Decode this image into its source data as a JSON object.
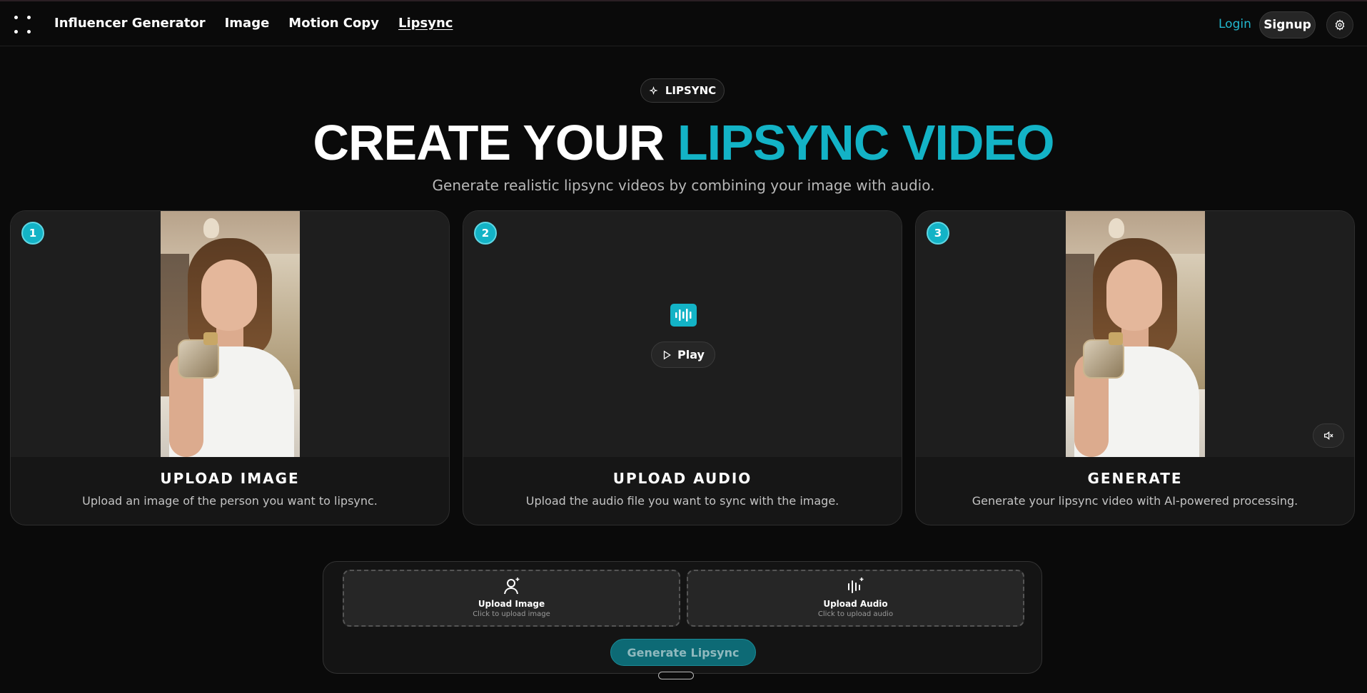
{
  "nav": {
    "links": [
      {
        "label": "Influencer Generator",
        "active": false
      },
      {
        "label": "Image",
        "active": false
      },
      {
        "label": "Motion Copy",
        "active": false
      },
      {
        "label": "Lipsync",
        "active": true
      }
    ],
    "login_label": "Login",
    "signup_label": "Signup",
    "settings_icon": "gear-icon"
  },
  "hero": {
    "badge": "LIPSYNC",
    "title_plain": "CREATE YOUR",
    "title_accent": "LIPSYNC VIDEO",
    "subtitle": "Generate realistic lipsync videos by combining your image with audio."
  },
  "steps": [
    {
      "number": "1",
      "title": "UPLOAD IMAGE",
      "description": "Upload an image of the person you want to lipsync."
    },
    {
      "number": "2",
      "title": "UPLOAD AUDIO",
      "description": "Upload the audio file you want to sync with the image.",
      "play_label": "Play"
    },
    {
      "number": "3",
      "title": "GENERATE",
      "description": "Generate your lipsync video with AI-powered processing."
    }
  ],
  "upload": {
    "image_title": "Upload Image",
    "image_sub": "Click to upload image",
    "audio_title": "Upload Audio",
    "audio_sub": "Click to upload audio",
    "generate_label": "Generate Lipsync"
  },
  "colors": {
    "accent": "#13b3c6",
    "background": "#0a0a0a",
    "card": "#161616"
  }
}
